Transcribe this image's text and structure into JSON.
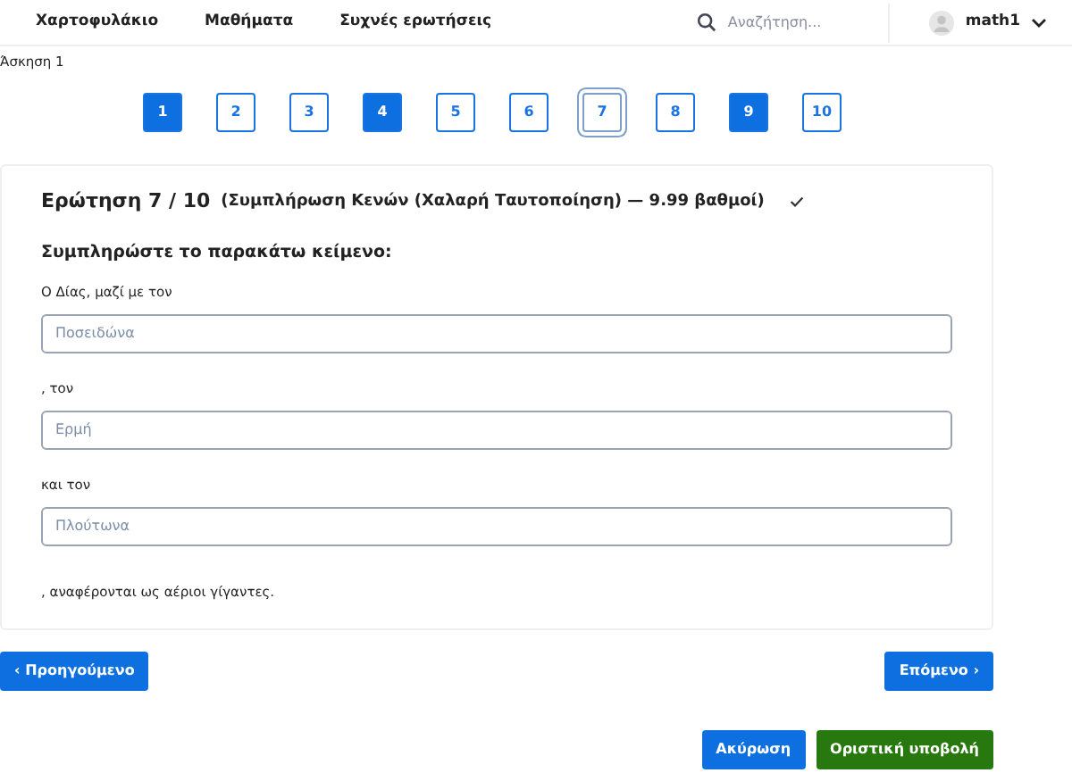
{
  "nav": {
    "links": [
      "Χαρτοφυλάκιο",
      "Μαθήματα",
      "Συχνές ερωτήσεις"
    ],
    "search": {
      "placeholder": "Αναζήτηση..."
    },
    "user": "math1"
  },
  "exercise_title": "Άσκηση 1",
  "pages": [
    {
      "label": "1",
      "answered": true,
      "selected": false
    },
    {
      "label": "2",
      "answered": false,
      "selected": false
    },
    {
      "label": "3",
      "answered": false,
      "selected": false
    },
    {
      "label": "4",
      "answered": true,
      "selected": false
    },
    {
      "label": "5",
      "answered": false,
      "selected": false
    },
    {
      "label": "6",
      "answered": false,
      "selected": false
    },
    {
      "label": "7",
      "answered": false,
      "selected": true
    },
    {
      "label": "8",
      "answered": false,
      "selected": false
    },
    {
      "label": "9",
      "answered": true,
      "selected": false
    },
    {
      "label": "10",
      "answered": false,
      "selected": false
    }
  ],
  "question": {
    "number": "Ερώτηση 7 / 10",
    "meta": "(Συμπλήρωση Κενών (Χαλαρή Ταυτοποίηση) — 9.99 βαθμοί)",
    "saved": true,
    "instruction": "Συμπληρώστε το παρακάτω κείμενο:",
    "parts": [
      {
        "kind": "text",
        "text": "Ο Δίας, μαζί με τον"
      },
      {
        "kind": "blank",
        "placeholder": "Ποσειδώνα"
      },
      {
        "kind": "text",
        "text": ", τον"
      },
      {
        "kind": "blank",
        "placeholder": "Ερμή"
      },
      {
        "kind": "text",
        "text": "και τον"
      },
      {
        "kind": "blank",
        "placeholder": "Πλούτωνα"
      },
      {
        "kind": "text",
        "text": ", αναφέρονται ως αέριοι γίγαντες."
      }
    ]
  },
  "prev_button": "‹ Προηγούμενο",
  "next_button": "Επόμενο ›",
  "cancel_button": "Ακύρωση",
  "submit_button": "Οριστική υποβολή"
}
